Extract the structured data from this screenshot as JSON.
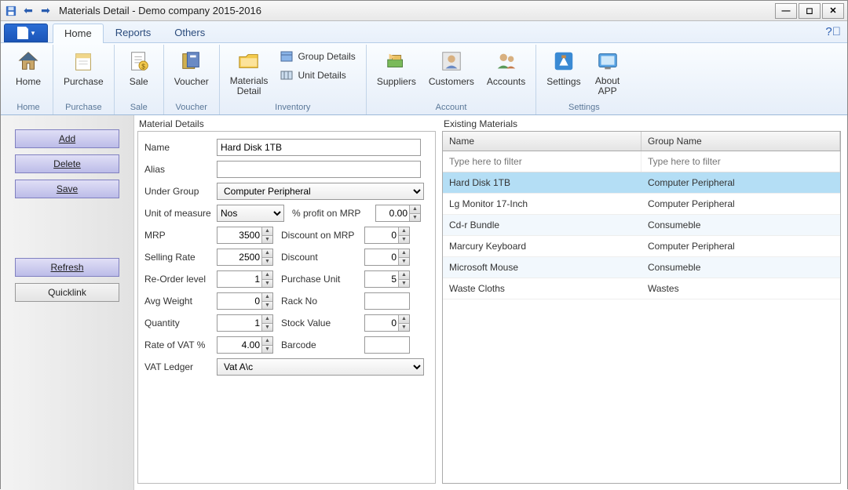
{
  "window": {
    "title": "Materials Detail - Demo company 2015-2016"
  },
  "tabs": {
    "file_caret": "▾",
    "home": "Home",
    "reports": "Reports",
    "others": "Others"
  },
  "ribbon": {
    "groups": {
      "home": {
        "label": "Home",
        "home_btn": "Home"
      },
      "purchase": {
        "label": "Purchase",
        "purchase_btn": "Purchase"
      },
      "sale": {
        "label": "Sale",
        "sale_btn": "Sale"
      },
      "voucher": {
        "label": "Voucher",
        "voucher_btn": "Voucher"
      },
      "inventory": {
        "label": "Inventory",
        "materials_detail_btn": "Materials\nDetail",
        "group_details": "Group Details",
        "unit_details": "Unit Details"
      },
      "account": {
        "label": "Account",
        "suppliers": "Suppliers",
        "customers": "Customers",
        "accounts": "Accounts"
      },
      "settings": {
        "label": "Settings",
        "settings_btn": "Settings",
        "about_btn": "About\nAPP"
      }
    }
  },
  "sidebar": {
    "add": "Add",
    "delete": "Delete",
    "save": "Save",
    "refresh": "Refresh",
    "quicklink": "Quicklink"
  },
  "details": {
    "title": "Material Details",
    "labels": {
      "name": "Name",
      "alias": "Alias",
      "under_group": "Under Group",
      "uom": "Unit of measure",
      "profit_mrp": "% profit on MRP",
      "mrp": "MRP",
      "discount_mrp": "Discount on MRP",
      "selling_rate": "Selling Rate",
      "discount": "Discount",
      "reorder": "Re-Order level",
      "purchase_unit": "Purchase Unit",
      "avg_weight": "Avg Weight",
      "rack_no": "Rack No",
      "quantity": "Quantity",
      "stock_value": "Stock Value",
      "rate_vat": "Rate of VAT %",
      "barcode": "Barcode",
      "vat_ledger": "VAT Ledger"
    },
    "values": {
      "name": "Hard Disk 1TB",
      "alias": "",
      "under_group": "Computer Peripheral",
      "uom": "Nos",
      "profit_mrp": "0.00",
      "mrp": "3500",
      "discount_mrp": "0",
      "selling_rate": "2500",
      "discount": "0",
      "reorder": "1",
      "purchase_unit": "5",
      "avg_weight": "0",
      "rack_no": "",
      "quantity": "1",
      "stock_value": "0",
      "rate_vat": "4.00",
      "barcode": "",
      "vat_ledger": "Vat A\\c"
    }
  },
  "existing": {
    "title": "Existing Materials",
    "columns": {
      "name": "Name",
      "group": "Group Name"
    },
    "filter_placeholder": "Type here to filter",
    "rows": [
      {
        "name": "Hard Disk 1TB",
        "group": "Computer Peripheral",
        "selected": true
      },
      {
        "name": "Lg Monitor 17-Inch",
        "group": "Computer Peripheral"
      },
      {
        "name": "Cd-r Bundle",
        "group": "Consumeble"
      },
      {
        "name": "Marcury Keyboard",
        "group": "Computer Peripheral"
      },
      {
        "name": "Microsoft Mouse",
        "group": "Consumeble"
      },
      {
        "name": "Waste Cloths",
        "group": "Wastes"
      }
    ]
  }
}
